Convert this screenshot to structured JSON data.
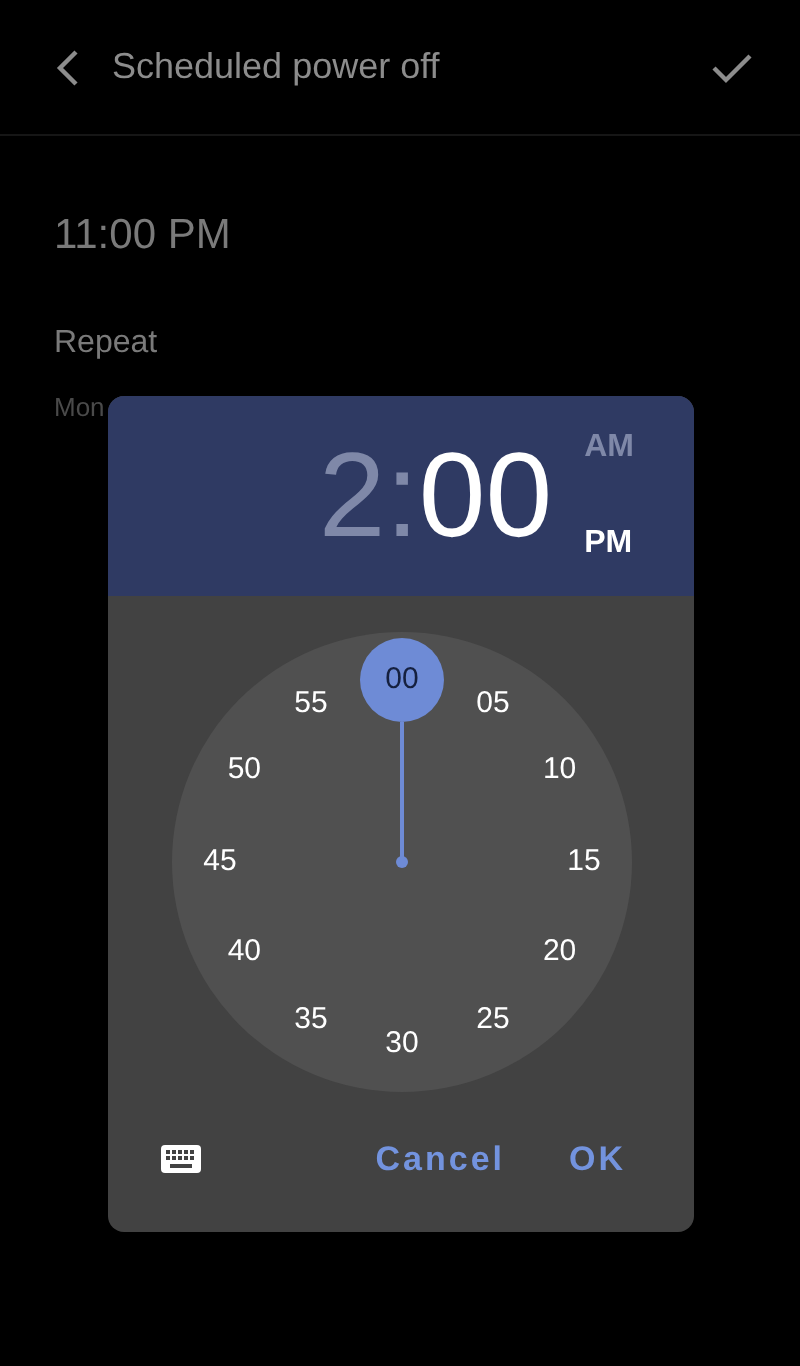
{
  "header": {
    "title": "Scheduled power off"
  },
  "time": "11:00 PM",
  "repeat": {
    "label": "Repeat",
    "days": "Mon"
  },
  "dialog": {
    "hour": {
      "text": "2",
      "selected": false
    },
    "separator": ":",
    "minute": {
      "text": "00",
      "selected": true
    },
    "periods": [
      {
        "label": "AM",
        "selected": false
      },
      {
        "label": "PM",
        "selected": true
      }
    ],
    "dial": [
      {
        "label": "00",
        "selected": true
      },
      {
        "label": "05",
        "selected": false
      },
      {
        "label": "10",
        "selected": false
      },
      {
        "label": "15",
        "selected": false
      },
      {
        "label": "20",
        "selected": false
      },
      {
        "label": "25",
        "selected": false
      },
      {
        "label": "30",
        "selected": false
      },
      {
        "label": "35",
        "selected": false
      },
      {
        "label": "40",
        "selected": false
      },
      {
        "label": "45",
        "selected": false
      },
      {
        "label": "50",
        "selected": false
      },
      {
        "label": "55",
        "selected": false
      }
    ],
    "buttons": [
      "Cancel",
      "OK"
    ]
  }
}
